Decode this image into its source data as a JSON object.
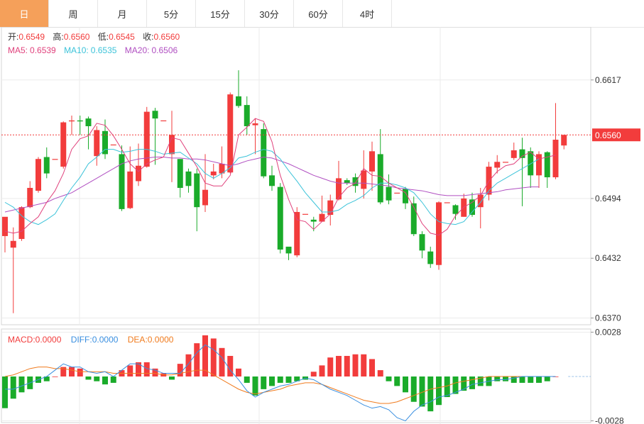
{
  "tabs": [
    {
      "label": "日",
      "active": true
    },
    {
      "label": "周",
      "active": false
    },
    {
      "label": "月",
      "active": false
    },
    {
      "label": "5分",
      "active": false
    },
    {
      "label": "15分",
      "active": false
    },
    {
      "label": "30分",
      "active": false
    },
    {
      "label": "60分",
      "active": false
    },
    {
      "label": "4时",
      "active": false
    }
  ],
  "colors": {
    "up": "#f23c3c",
    "down": "#1aab2a",
    "ma5": "#e0417c",
    "ma10": "#3cc3d9",
    "ma20": "#b04fc1",
    "macd": "#f23c3c",
    "diff": "#3a8fe0",
    "dea": "#f07b1e",
    "grid": "#ebebeb",
    "price_tag": "#f23c3c"
  },
  "legend": {
    "ohlc": [
      {
        "name": "开:",
        "value": "0.6549"
      },
      {
        "name": "高:",
        "value": "0.6560"
      },
      {
        "name": "低:",
        "value": "0.6545"
      },
      {
        "name": "收:",
        "value": "0.6560"
      }
    ],
    "ma": [
      {
        "name": "MA5:",
        "value": "0.6539"
      },
      {
        "name": "MA10:",
        "value": "0.6535"
      },
      {
        "name": "MA20:",
        "value": "0.6506"
      }
    ],
    "macd": [
      {
        "name": "MACD:",
        "value": "0.0000"
      },
      {
        "name": "DIFF:",
        "value": "0.0000"
      },
      {
        "name": "DEA:",
        "value": "0.0000"
      }
    ]
  },
  "chart_data": [
    {
      "type": "candlestick",
      "y_ticks": [
        "0.6617",
        "0.6494",
        "0.6432",
        "0.6370"
      ],
      "ylim": [
        0.6363,
        0.6672
      ],
      "current_price": {
        "label": "0.6560",
        "value": 0.656
      },
      "candles": [
        [
          0.6455,
          0.6475,
          0.6455,
          0.6438
        ],
        [
          0.6443,
          0.645,
          0.6464,
          0.6375
        ],
        [
          0.6452,
          0.6485,
          0.6486,
          0.645
        ],
        [
          0.6485,
          0.6505,
          0.6512,
          0.6484
        ],
        [
          0.6502,
          0.6535,
          0.6537,
          0.65
        ],
        [
          0.6537,
          0.652,
          0.6547,
          0.6515
        ],
        [
          0.6535,
          0.6535,
          0.6535,
          0.6535
        ],
        [
          0.6527,
          0.6573,
          0.6574,
          0.6525
        ],
        [
          0.6574,
          0.6575,
          0.658,
          0.656
        ],
        [
          0.6575,
          0.6574,
          0.658,
          0.656
        ],
        [
          0.6577,
          0.6569,
          0.6579,
          0.6545
        ],
        [
          0.6538,
          0.6565,
          0.6569,
          0.6528
        ],
        [
          0.6564,
          0.654,
          0.6576,
          0.6535
        ],
        [
          0.655,
          0.655,
          0.655,
          0.655
        ],
        [
          0.654,
          0.6483,
          0.6549,
          0.6481
        ],
        [
          0.6484,
          0.6522,
          0.6548,
          0.6483
        ],
        [
          0.6512,
          0.6528,
          0.6551,
          0.6507
        ],
        [
          0.6527,
          0.6584,
          0.6589,
          0.6526
        ],
        [
          0.6585,
          0.6577,
          0.6588,
          0.6529
        ],
        [
          0.6575,
          0.6575,
          0.6575,
          0.6575
        ],
        [
          0.654,
          0.656,
          0.6585,
          0.6511
        ],
        [
          0.6535,
          0.6505,
          0.6535,
          0.6495
        ],
        [
          0.6522,
          0.6507,
          0.6525,
          0.65
        ],
        [
          0.652,
          0.6485,
          0.6525,
          0.646
        ],
        [
          0.6487,
          0.6503,
          0.654,
          0.648
        ],
        [
          0.6518,
          0.6522,
          0.653,
          0.6514
        ],
        [
          0.652,
          0.653,
          0.6548,
          0.6515
        ],
        [
          0.6521,
          0.6602,
          0.6604,
          0.652
        ],
        [
          0.66,
          0.659,
          0.6627,
          0.6588
        ],
        [
          0.6591,
          0.6569,
          0.66,
          0.656
        ],
        [
          0.657,
          0.6572,
          0.6577,
          0.654
        ],
        [
          0.6566,
          0.6517,
          0.6572,
          0.6515
        ],
        [
          0.6518,
          0.6507,
          0.6528,
          0.6502
        ],
        [
          0.6506,
          0.6441,
          0.651,
          0.6437
        ],
        [
          0.6444,
          0.6437,
          0.644,
          0.643
        ],
        [
          0.6435,
          0.648,
          0.6485,
          0.6433
        ],
        [
          0.6478,
          0.6478,
          0.6478,
          0.6478
        ],
        [
          0.6472,
          0.647,
          0.6475,
          0.646
        ],
        [
          0.647,
          0.6478,
          0.6497,
          0.647
        ],
        [
          0.6477,
          0.6492,
          0.6498,
          0.6466
        ],
        [
          0.6493,
          0.6515,
          0.6533,
          0.6492
        ],
        [
          0.6513,
          0.651,
          0.6515,
          0.6508
        ],
        [
          0.6516,
          0.6507,
          0.652,
          0.65
        ],
        [
          0.6504,
          0.6523,
          0.6544,
          0.6494
        ],
        [
          0.6522,
          0.6543,
          0.6553,
          0.6502
        ],
        [
          0.654,
          0.649,
          0.6566,
          0.6488
        ],
        [
          0.6506,
          0.6492,
          0.6519,
          0.6488
        ],
        [
          0.65,
          0.65,
          0.65,
          0.65
        ],
        [
          0.6504,
          0.6489,
          0.6506,
          0.6483
        ],
        [
          0.6489,
          0.6457,
          0.6496,
          0.6455
        ],
        [
          0.6457,
          0.644,
          0.646,
          0.6432
        ],
        [
          0.6439,
          0.6426,
          0.6444,
          0.6422
        ],
        [
          0.6425,
          0.649,
          0.6491,
          0.642
        ],
        [
          0.649,
          0.649,
          0.649,
          0.649
        ],
        [
          0.6487,
          0.6478,
          0.6488,
          0.6472
        ],
        [
          0.6475,
          0.6494,
          0.6499,
          0.6475
        ],
        [
          0.6493,
          0.6477,
          0.65,
          0.6475
        ],
        [
          0.6485,
          0.6498,
          0.6505,
          0.6463
        ],
        [
          0.6498,
          0.6527,
          0.6532,
          0.6492
        ],
        [
          0.6526,
          0.6532,
          0.6539,
          0.652
        ],
        [
          0.6532,
          0.6532,
          0.6532,
          0.6532
        ],
        [
          0.6536,
          0.6544,
          0.6552,
          0.6534
        ],
        [
          0.6545,
          0.6536,
          0.6557,
          0.6486
        ],
        [
          0.6543,
          0.6518,
          0.6547,
          0.6505
        ],
        [
          0.6518,
          0.654,
          0.6543,
          0.6505
        ],
        [
          0.6542,
          0.6516,
          0.6543,
          0.6505
        ],
        [
          0.6516,
          0.6555,
          0.6593,
          0.6514
        ],
        [
          0.6549,
          0.656,
          0.656,
          0.6545
        ]
      ],
      "ma5": [
        0.646,
        0.6458,
        0.646,
        0.6468,
        0.6475,
        0.649,
        0.6502,
        0.652,
        0.6545,
        0.6556,
        0.6559,
        0.6572,
        0.657,
        0.6559,
        0.6545,
        0.653,
        0.6522,
        0.653,
        0.6534,
        0.6537,
        0.6557,
        0.6555,
        0.6541,
        0.6527,
        0.651,
        0.6507,
        0.6507,
        0.6518,
        0.656,
        0.6568,
        0.6577,
        0.6574,
        0.6553,
        0.6518,
        0.6493,
        0.6472,
        0.647,
        0.6462,
        0.647,
        0.6478,
        0.6495,
        0.6505,
        0.651,
        0.6525,
        0.6518,
        0.6517,
        0.651,
        0.6505,
        0.65,
        0.6485,
        0.6468,
        0.6458,
        0.6456,
        0.6462,
        0.6476,
        0.6485,
        0.649,
        0.6497,
        0.6512,
        0.6522,
        0.6528,
        0.653,
        0.6538,
        0.6542,
        0.6535,
        0.6537,
        0.6539
      ],
      "ma10": [
        0.649,
        0.6485,
        0.6476,
        0.647,
        0.6467,
        0.6472,
        0.6478,
        0.6492,
        0.6505,
        0.6516,
        0.653,
        0.6537,
        0.6545,
        0.6545,
        0.6542,
        0.6543,
        0.6545,
        0.6545,
        0.6543,
        0.654,
        0.6541,
        0.6542,
        0.6536,
        0.653,
        0.652,
        0.6515,
        0.652,
        0.6526,
        0.6536,
        0.6538,
        0.6542,
        0.6545,
        0.6543,
        0.6535,
        0.6523,
        0.6512,
        0.65,
        0.649,
        0.648,
        0.648,
        0.6482,
        0.6488,
        0.6492,
        0.6497,
        0.6505,
        0.651,
        0.651,
        0.6508,
        0.6505,
        0.65,
        0.649,
        0.6478,
        0.647,
        0.6468,
        0.6467,
        0.647,
        0.648,
        0.649,
        0.6502,
        0.651,
        0.6515,
        0.652,
        0.6525,
        0.653,
        0.6535
      ],
      "ma20": [
        0.648,
        0.6482,
        0.6484,
        0.6486,
        0.6488,
        0.649,
        0.6494,
        0.6497,
        0.65,
        0.6505,
        0.651,
        0.6515,
        0.652,
        0.6525,
        0.653,
        0.6533,
        0.6535,
        0.6536,
        0.6537,
        0.6537,
        0.6536,
        0.6536,
        0.6535,
        0.6535,
        0.6534,
        0.6532,
        0.653,
        0.6528,
        0.653,
        0.6533,
        0.6535,
        0.6537,
        0.6536,
        0.6533,
        0.653,
        0.6526,
        0.6522,
        0.6518,
        0.6515,
        0.6512,
        0.651,
        0.651,
        0.651,
        0.651,
        0.6509,
        0.6508,
        0.6507,
        0.6505,
        0.6504,
        0.6503,
        0.6502,
        0.65,
        0.6498,
        0.6497,
        0.6497,
        0.6497,
        0.6498,
        0.6499,
        0.65,
        0.6501,
        0.6503,
        0.6504,
        0.6505,
        0.6506,
        0.6506
      ]
    },
    {
      "type": "bar",
      "y_ticks": [
        "0.0028",
        "-0.0028"
      ],
      "ylim": [
        -0.003,
        0.003
      ],
      "macd": [
        -0.002,
        -0.0014,
        -0.001,
        -0.0008,
        -0.0004,
        -0.0003,
        0.0,
        0.0006,
        0.0006,
        0.0005,
        -0.0002,
        -0.0003,
        -0.0005,
        -0.0004,
        0.0004,
        0.0007,
        0.0009,
        0.0009,
        0.0005,
        0.0002,
        -0.0002,
        0.0008,
        0.0014,
        0.0021,
        0.0026,
        0.0024,
        0.0018,
        0.0013,
        0.0005,
        -0.0004,
        -0.0012,
        -0.0008,
        -0.0006,
        -0.0004,
        -0.0004,
        -0.0003,
        -0.0002,
        0.0003,
        0.0007,
        0.0012,
        0.0013,
        0.0013,
        0.0014,
        0.0014,
        0.0011,
        0.0004,
        -0.0003,
        -0.0006,
        -0.001,
        -0.0016,
        -0.0019,
        -0.0022,
        -0.0018,
        -0.0013,
        -0.0011,
        -0.0009,
        -0.0008,
        -0.0006,
        -0.0006,
        -0.0003,
        -0.0003,
        -0.0004,
        -0.0004,
        -0.0004,
        -0.0004,
        -0.0003,
        0.0
      ],
      "diff": [
        -0.0008,
        -0.0008,
        -0.0006,
        -0.0004,
        -0.0002,
        0.0,
        0.0004,
        0.0008,
        0.0006,
        0.0006,
        0.0003,
        0.0002,
        0.0003,
        0.0,
        0.0004,
        0.0008,
        0.0008,
        0.0005,
        0.0004,
        0.0002,
        0.0002,
        0.0002,
        0.0008,
        0.0015,
        0.002,
        0.0017,
        0.0012,
        0.0004,
        -0.0002,
        -0.0009,
        -0.0013,
        -0.001,
        -0.0008,
        -0.0006,
        -0.0005,
        -0.0003,
        -0.0001,
        -0.0002,
        -0.0005,
        -0.0008,
        -0.001,
        -0.0012,
        -0.0015,
        -0.0018,
        -0.002,
        -0.0019,
        -0.0021,
        -0.0026,
        -0.0028,
        -0.0022,
        -0.0018,
        -0.0016,
        -0.0013,
        -0.0012,
        -0.001,
        -0.0008,
        -0.0005,
        -0.0004,
        -0.0003,
        -0.0002,
        -0.0002,
        -0.0001,
        0.0,
        0.0,
        0.0,
        0.0,
        0.0
      ],
      "dea": [
        0.0,
        0.0001,
        0.0003,
        0.0005,
        0.0006,
        0.0006,
        0.0005,
        0.0005,
        0.0004,
        0.0003,
        0.0003,
        0.0003,
        0.0003,
        0.0002,
        0.0002,
        0.0002,
        0.0002,
        0.0002,
        0.0002,
        0.0001,
        0.0001,
        0.0002,
        0.0003,
        0.0004,
        0.0004,
        0.0001,
        -0.0002,
        -0.0005,
        -0.0008,
        -0.001,
        -0.0011,
        -0.001,
        -0.0009,
        -0.0008,
        -0.0006,
        -0.0005,
        -0.0004,
        -0.0004,
        -0.0005,
        -0.0007,
        -0.0009,
        -0.0011,
        -0.0013,
        -0.0015,
        -0.0016,
        -0.0017,
        -0.0017,
        -0.0016,
        -0.0014,
        -0.0012,
        -0.001,
        -0.0008,
        -0.0007,
        -0.0006,
        -0.0004,
        -0.0003,
        -0.0002,
        -0.0001,
        0.0,
        0.0,
        0.0,
        0.0,
        0.0,
        0.0,
        0.0,
        0.0,
        0.0
      ]
    }
  ]
}
